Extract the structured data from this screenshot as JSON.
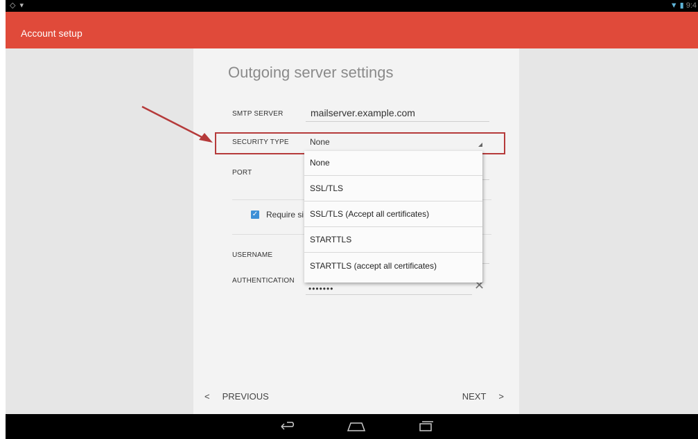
{
  "status_bar": {
    "left_icons": [
      "circle-icon",
      "signal-icon"
    ],
    "right_icons": [
      "wifi-icon",
      "battery-icon"
    ],
    "time": "9:4"
  },
  "action_bar": {
    "title": "Account setup"
  },
  "page": {
    "heading": "Outgoing server settings"
  },
  "fields": {
    "smtp_server": {
      "label": "SMTP SERVER",
      "value": "mailserver.example.com"
    },
    "security_type": {
      "label": "SECURITY TYPE",
      "value": "None"
    },
    "port": {
      "label": "PORT"
    },
    "require_signin": {
      "label": "Require si",
      "checked": true
    },
    "username": {
      "label": "USERNAME"
    },
    "authentication": {
      "label": "AUTHENTICATION",
      "value": "•••••••"
    }
  },
  "dropdown": {
    "options": [
      "None",
      "SSL/TLS",
      "SSL/TLS (Accept all certificates)",
      "STARTTLS",
      "STARTTLS (accept all certificates)"
    ]
  },
  "navigation": {
    "previous": "PREVIOUS",
    "next": "NEXT",
    "previous_glyph": "<",
    "next_glyph": ">"
  },
  "colors": {
    "action_bar": "#e04a3a",
    "highlight_border": "#b53a3a",
    "arrow": "#b53a3a",
    "checkbox": "#3d8fd6"
  },
  "system_nav": [
    "back-icon",
    "home-icon",
    "recents-icon"
  ]
}
